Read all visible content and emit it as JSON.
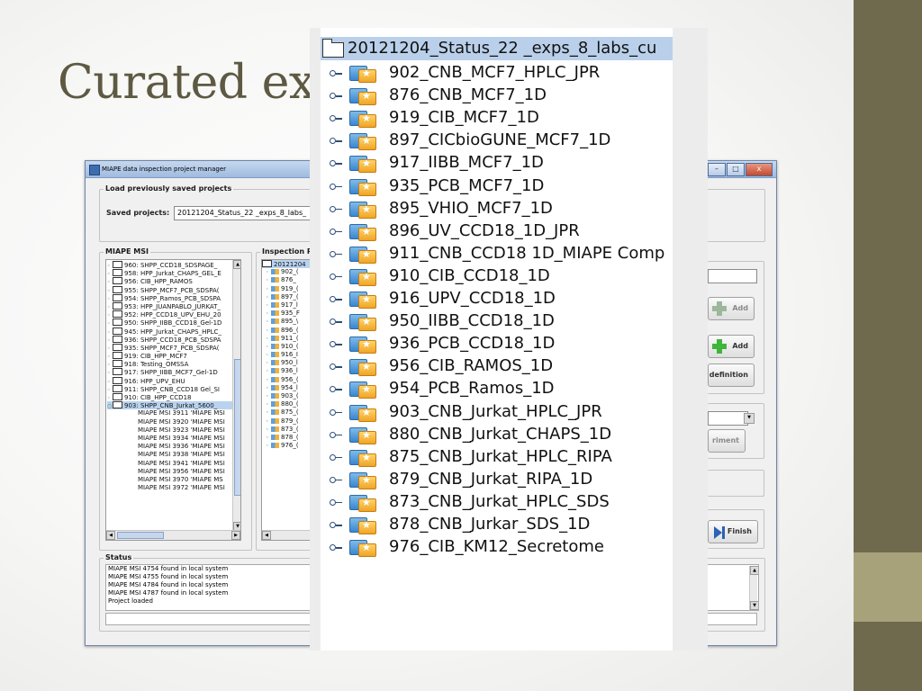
{
  "slide": {
    "title": "Curated ex"
  },
  "window": {
    "title": "MIAPE data inspection project manager",
    "buttons": {
      "minimize": "–",
      "maximize": "□",
      "close": "x"
    },
    "load_group_label": "Load previously saved projects",
    "saved_projects_label": "Saved projects:",
    "saved_projects_value": "20121204_Status_22 _exps_8_labs_",
    "miape_msi_label": "MIAPE MSI",
    "miape_msi_items": [
      "960: SHPP_CCD18_SDSPAGE_",
      "958: HPP_Jurkat_CHAPS_GEL_E",
      "956: CIB_HPP_RAMOS",
      "955: SHPP_MCF7_PCB_SDSPA(",
      "954: SHPP_Ramos_PCB_SDSPA",
      "953: HPP_JUANPABLO_JURKAT_",
      "952: HPP_CCD18_UPV_EHU_20",
      "950: SHPP_IIBB_CCD18_Gel-1D",
      "945: HPP_Jurkat_CHAPS_HPLC_",
      "936: SHPP_CCD18_PCB_SDSPA",
      "935: SHPP_MCF7_PCB_SDSPA(",
      "919: CIB_HPP_MCF7",
      "918: Testing_OMSSA",
      "917: SHPP_IIBB_MCF7_Gel-1D",
      "916: HPP_UPV_EHU",
      "911: SHPP_CNB_CCD18 Gel_SI",
      "910: CIB_HPP_CCD18",
      "903: SHPP_CNB_Jurkat_5600_"
    ],
    "miape_msi_children": [
      "MIAPE MSI 3911 'MIAPE MSI",
      "MIAPE MSI 3920 'MIAPE MSI",
      "MIAPE MSI 3923 'MIAPE MSI",
      "MIAPE MSI 3934 'MIAPE MSI",
      "MIAPE MSI 3936 'MIAPE MSI",
      "MIAPE MSI 3938 'MIAPE MSI",
      "MIAPE MSI 3941 'MIAPE MSI",
      "MIAPE MSI 3956 'MIAPE MSI",
      "MIAPE MSI 3970 'MIAPE MS",
      "MIAPE MSI 3972 'MIAPE MSI"
    ],
    "inspection_label": "Inspection Pr",
    "inspection_root": "20121204",
    "inspection_items": [
      "902_(",
      "876_",
      "919_(",
      "897_(",
      "917_l",
      "935_F",
      "895_\\",
      "896_(",
      "911_(",
      "910_(",
      "916_I",
      "950_l",
      "936_l",
      "956_(",
      "954_l",
      "903_(",
      "880_(",
      "875_(",
      "879_(",
      "873_(",
      "878_(",
      "976_("
    ],
    "add_disabled_label": "Add",
    "add_label": "Add",
    "definition_label": "definition",
    "experiment_label": "riment",
    "finish_label": "Finish",
    "status_label": "Status",
    "status_lines": [
      "MIAPE MSI 4754 found in local system",
      "MIAPE MSI 4755 found in local system",
      "MIAPE MSI 4784 found in local system",
      "MIAPE MSI 4787 found in local system",
      "Project loaded"
    ]
  },
  "zoom": {
    "root": "20121204_Status_22 _exps_8_labs_cu",
    "items": [
      "902_CNB_MCF7_HPLC_JPR",
      "876_CNB_MCF7_1D",
      "919_CIB_MCF7_1D",
      "897_CICbioGUNE_MCF7_1D",
      "917_IIBB_MCF7_1D",
      "935_PCB_MCF7_1D",
      "895_VHIO_MCF7_1D",
      "896_UV_CCD18_1D_JPR",
      "911_CNB_CCD18 1D_MIAPE Comp",
      "910_CIB_CCD18_1D",
      "916_UPV_CCD18_1D",
      "950_IIBB_CCD18_1D",
      "936_PCB_CCD18_1D",
      "956_CIB_RAMOS_1D",
      "954_PCB_Ramos_1D",
      "903_CNB_Jurkat_HPLC_JPR",
      "880_CNB_Jurkat_CHAPS_1D",
      "875_CNB_Jurkat_HPLC_RIPA",
      "879_CNB_Jurkat_RIPA_1D",
      "873_CNB_Jurkat_HPLC_SDS",
      "878_CNB_Jurkar_SDS_1D",
      "976_CIB_KM12_Secretome"
    ]
  },
  "colors": {
    "title": "#5d5942",
    "side_dark": "#6f6a4e",
    "side_light": "#a8a27b",
    "selection": "#bad0ea"
  }
}
